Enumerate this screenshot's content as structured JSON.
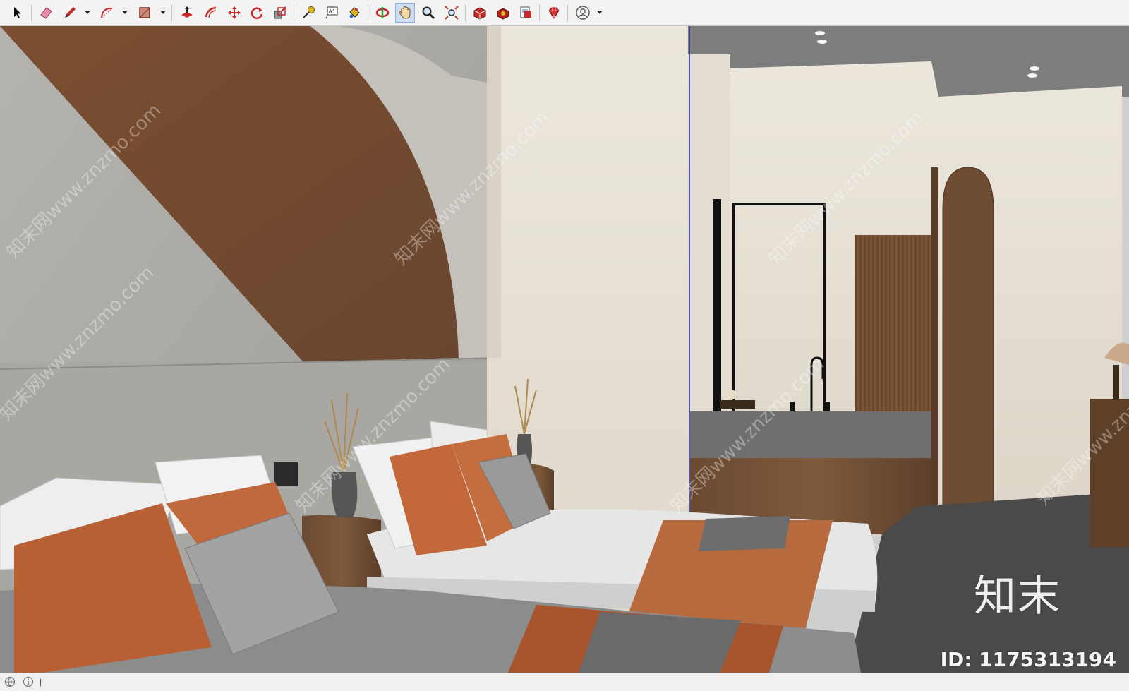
{
  "toolbar": {
    "tools": [
      {
        "name": "select-tool",
        "icon": "arrow-cursor-icon",
        "active": false
      },
      {
        "name": "eraser-tool",
        "icon": "eraser-icon",
        "active": false
      },
      {
        "name": "pencil-tool",
        "icon": "pencil-icon",
        "active": false,
        "dropdown": true
      },
      {
        "name": "arc-tool",
        "icon": "arc-icon",
        "active": false,
        "dropdown": true
      },
      {
        "name": "rectangle-tool",
        "icon": "rectangle-icon",
        "active": false,
        "dropdown": true
      },
      {
        "name": "push-pull-tool",
        "icon": "push-pull-icon",
        "active": false
      },
      {
        "name": "offset-tool",
        "icon": "offset-icon",
        "active": false
      },
      {
        "name": "move-tool",
        "icon": "move-icon",
        "active": false
      },
      {
        "name": "rotate-tool",
        "icon": "rotate-icon",
        "active": false
      },
      {
        "name": "scale-tool",
        "icon": "scale-icon",
        "active": false
      },
      {
        "name": "tape-measure-tool",
        "icon": "tape-measure-icon",
        "active": false
      },
      {
        "name": "text-tool",
        "icon": "text-icon",
        "active": false
      },
      {
        "name": "paint-bucket-tool",
        "icon": "paint-bucket-icon",
        "active": false
      },
      {
        "name": "orbit-tool",
        "icon": "orbit-icon",
        "active": false
      },
      {
        "name": "pan-tool",
        "icon": "hand-icon",
        "active": true
      },
      {
        "name": "zoom-tool",
        "icon": "magnifier-icon",
        "active": false
      },
      {
        "name": "zoom-extents-tool",
        "icon": "zoom-extents-icon",
        "active": false
      },
      {
        "name": "warehouse-tool",
        "icon": "warehouse-icon",
        "active": false
      },
      {
        "name": "extension-warehouse-tool",
        "icon": "extension-warehouse-icon",
        "active": false
      },
      {
        "name": "send-to-layout-tool",
        "icon": "layout-icon",
        "active": false
      },
      {
        "name": "extension-manager-tool",
        "icon": "ruby-icon",
        "active": false
      },
      {
        "name": "account-button",
        "icon": "user-icon",
        "active": false,
        "dropdown": true
      }
    ]
  },
  "viewport": {
    "watermark_logo": "知末",
    "watermark_id": "ID: 1175313194",
    "watermark_repeat": "知末网www.znzmo.com"
  },
  "statusbar": {
    "icons": [
      "globe-icon",
      "info-icon"
    ],
    "separator": "|"
  },
  "colors": {
    "toolbar_bg": "#f3f3f3",
    "active_tool_bg": "#cfe0f5",
    "accent_red": "#d32b2b",
    "terracotta": "#b76a3d",
    "brown_wall": "#6d4a33",
    "plaster": "#e6e0d6"
  }
}
